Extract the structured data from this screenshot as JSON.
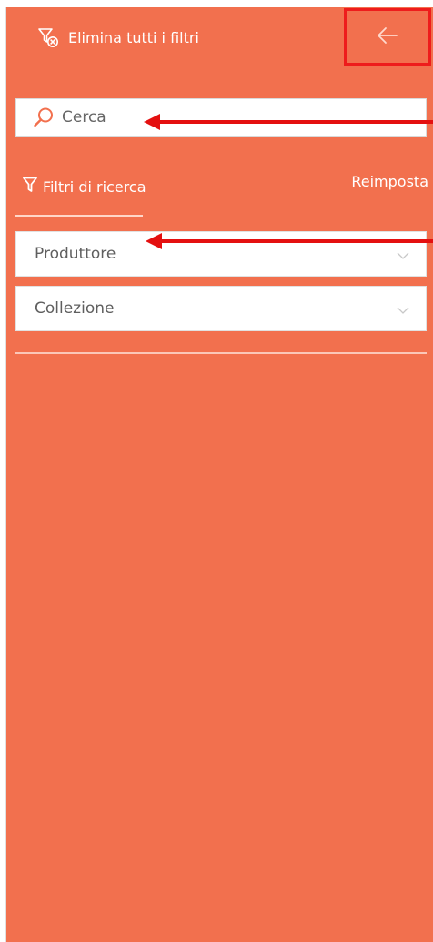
{
  "header": {
    "clear_all_label": "Elimina tutti i filtri",
    "clear_all_icon": "filter-clear-icon",
    "back_icon": "arrow-left-icon"
  },
  "search": {
    "placeholder": "Cerca",
    "value": "",
    "icon": "search-icon"
  },
  "filters": {
    "title": "Filtri di ricerca",
    "title_icon": "filter-icon",
    "reset_label": "Reimposta",
    "dropdowns": [
      {
        "label": "Produttore",
        "icon": "chevron-down-icon"
      },
      {
        "label": "Collezione",
        "icon": "chevron-down-icon"
      }
    ]
  },
  "colors": {
    "panel_background": "#f2704e",
    "annotation_red": "#e41010",
    "accent": "#f2704e"
  }
}
